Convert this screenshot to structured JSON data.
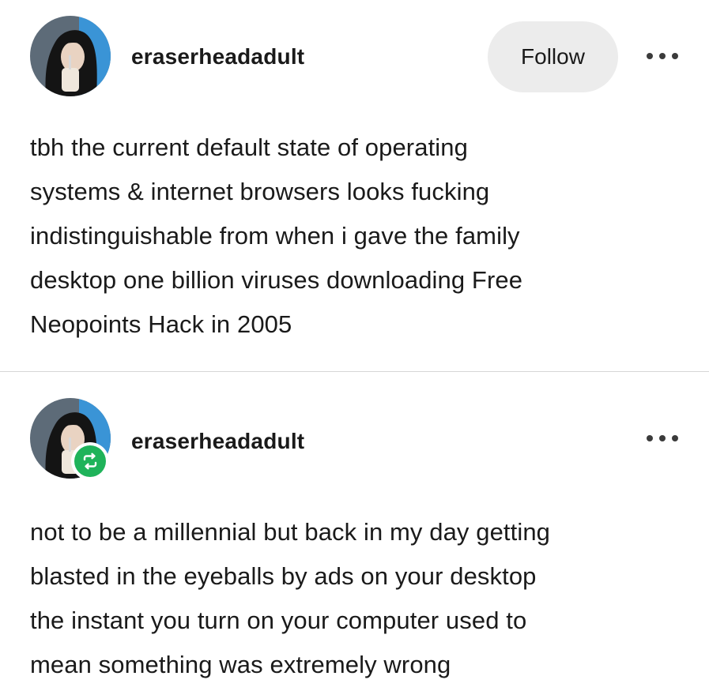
{
  "original_post": {
    "username": "eraserheadadult",
    "follow_label": "Follow",
    "body_lines": [
      "tbh the current default state of operating",
      "systems & internet browsers looks fucking",
      "indistinguishable from when i gave the family",
      "desktop one billion viruses downloading Free",
      "Neopoints Hack in 2005"
    ]
  },
  "reblog_post": {
    "username": "eraserheadadult",
    "body_lines": [
      "not to be a millennial but back in my day getting",
      "blasted in the eyeballs by ads on your desktop",
      "the instant you turn on your computer used to",
      "mean something was extremely wrong"
    ]
  },
  "icons": {
    "more": "more-options-icon",
    "reblog": "reblog-icon"
  },
  "colors": {
    "text": "#1a1a1a",
    "follow_button_bg": "#ececec",
    "reblog_badge": "#1fb35a",
    "divider": "#d6d6d6"
  }
}
